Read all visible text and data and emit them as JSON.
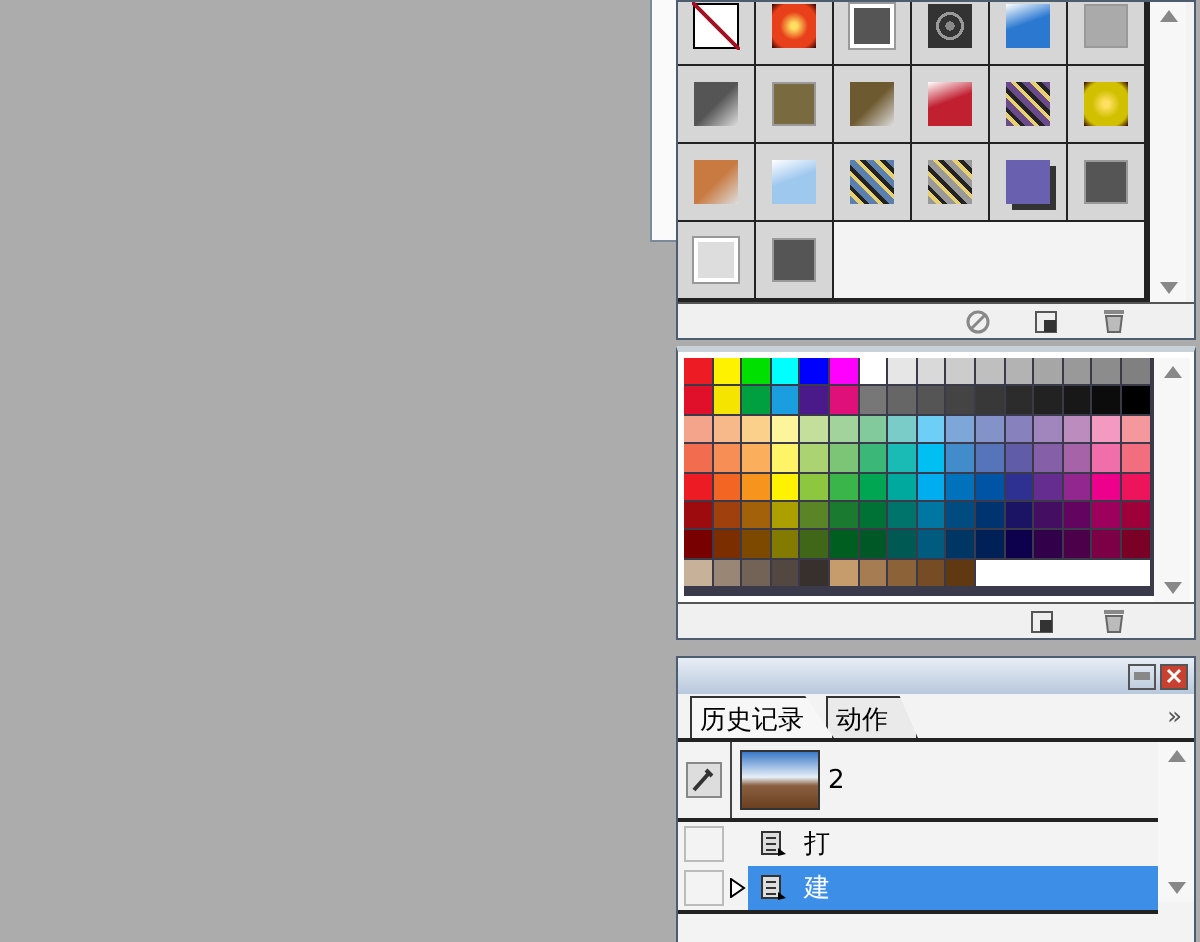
{
  "styles_panel": {
    "tiles": [
      {
        "kind": "none",
        "color": "#ffffff"
      },
      {
        "kind": "glow",
        "color": "#e8401a"
      },
      {
        "kind": "framed",
        "color": "#555555"
      },
      {
        "kind": "chrome",
        "color": "#333333"
      },
      {
        "kind": "glossy",
        "color": "#2a78d0"
      },
      {
        "kind": "flat",
        "color": "#aaaaaa"
      },
      {
        "kind": "gradient",
        "color": "#555555"
      },
      {
        "kind": "flat",
        "color": "#7a6a40"
      },
      {
        "kind": "gradient",
        "color": "#6e5a30"
      },
      {
        "kind": "glossy",
        "color": "#c02030"
      },
      {
        "kind": "pattern",
        "color": "#6a4a8a"
      },
      {
        "kind": "glow",
        "color": "#d0c000"
      },
      {
        "kind": "gradient",
        "color": "#c87a40"
      },
      {
        "kind": "glossy",
        "color": "#9fc8ef"
      },
      {
        "kind": "pattern",
        "color": "#5a80b0"
      },
      {
        "kind": "pattern",
        "color": "#999999"
      },
      {
        "kind": "shadow",
        "color": "#6a60b0"
      },
      {
        "kind": "flat",
        "color": "#555555"
      },
      {
        "kind": "framed",
        "color": "#dddddd"
      },
      {
        "kind": "flat",
        "color": "#555555"
      }
    ]
  },
  "swatches_panel": {
    "rows": [
      [
        {
          "color": "#ed1c24"
        },
        {
          "color": "#fff200"
        },
        {
          "color": "#00e000"
        },
        {
          "color": "#00ffff"
        },
        {
          "color": "#0000ff"
        },
        {
          "color": "#ff00ff"
        },
        {
          "color": "#ffffff"
        },
        {
          "color": "#e6e6e6"
        },
        {
          "color": "#d9d9d9"
        },
        {
          "color": "#cccccc"
        },
        {
          "color": "#bfbfbf"
        },
        {
          "color": "#b3b3b3"
        },
        {
          "color": "#a6a6a6"
        },
        {
          "color": "#999999"
        },
        {
          "color": "#8c8c8c"
        },
        {
          "color": "#808080"
        }
      ],
      [
        {
          "color": "#e0102a"
        },
        {
          "color": "#f5e400"
        },
        {
          "color": "#00a040"
        },
        {
          "color": "#1a9ee0"
        },
        {
          "color": "#4a1a8a"
        },
        {
          "color": "#e0107a"
        },
        {
          "color": "#777777"
        },
        {
          "color": "#666666"
        },
        {
          "color": "#555555"
        },
        {
          "color": "#444444"
        },
        {
          "color": "#383838"
        },
        {
          "color": "#2c2c2c"
        },
        {
          "color": "#222222"
        },
        {
          "color": "#181818"
        },
        {
          "color": "#0c0c0c"
        },
        {
          "color": "#000000"
        }
      ],
      [
        {
          "color": "#f4a48a"
        },
        {
          "color": "#f7b88a"
        },
        {
          "color": "#fbd08a"
        },
        {
          "color": "#fdf59c"
        },
        {
          "color": "#c4df9b"
        },
        {
          "color": "#a3d39c"
        },
        {
          "color": "#82ca9c"
        },
        {
          "color": "#7accc8"
        },
        {
          "color": "#6dcff6"
        },
        {
          "color": "#7da7d9"
        },
        {
          "color": "#8393ca"
        },
        {
          "color": "#8781bd"
        },
        {
          "color": "#a186be"
        },
        {
          "color": "#bd8cbf"
        },
        {
          "color": "#f49ac1"
        },
        {
          "color": "#f5989d"
        }
      ],
      [
        {
          "color": "#f26c4f"
        },
        {
          "color": "#f68e55"
        },
        {
          "color": "#fbaf5c"
        },
        {
          "color": "#fff467"
        },
        {
          "color": "#acd372"
        },
        {
          "color": "#7cc576"
        },
        {
          "color": "#3bb878"
        },
        {
          "color": "#1abbb4"
        },
        {
          "color": "#00bff3"
        },
        {
          "color": "#438ccb"
        },
        {
          "color": "#5574b9"
        },
        {
          "color": "#605ca8"
        },
        {
          "color": "#855fa8"
        },
        {
          "color": "#a763a8"
        },
        {
          "color": "#f06ea9"
        },
        {
          "color": "#f26d7d"
        }
      ],
      [
        {
          "color": "#ed1c24"
        },
        {
          "color": "#f26522"
        },
        {
          "color": "#f7941d"
        },
        {
          "color": "#fff200"
        },
        {
          "color": "#8dc63f"
        },
        {
          "color": "#39b54a"
        },
        {
          "color": "#00a651"
        },
        {
          "color": "#00a99d"
        },
        {
          "color": "#00aeef"
        },
        {
          "color": "#0072bc"
        },
        {
          "color": "#0054a6"
        },
        {
          "color": "#2e3192"
        },
        {
          "color": "#662d91"
        },
        {
          "color": "#92278f"
        },
        {
          "color": "#ec008c"
        },
        {
          "color": "#ed145b"
        }
      ],
      [
        {
          "color": "#9e0b0f"
        },
        {
          "color": "#a0410d"
        },
        {
          "color": "#a36209"
        },
        {
          "color": "#aba000"
        },
        {
          "color": "#598527"
        },
        {
          "color": "#1a7b30"
        },
        {
          "color": "#007236"
        },
        {
          "color": "#00746b"
        },
        {
          "color": "#0076a3"
        },
        {
          "color": "#004b80"
        },
        {
          "color": "#003471"
        },
        {
          "color": "#1b1464"
        },
        {
          "color": "#440e62"
        },
        {
          "color": "#630460"
        },
        {
          "color": "#9e005d"
        },
        {
          "color": "#9e0039"
        }
      ],
      [
        {
          "color": "#790000"
        },
        {
          "color": "#7b2e00"
        },
        {
          "color": "#7d4900"
        },
        {
          "color": "#827b00"
        },
        {
          "color": "#406618"
        },
        {
          "color": "#005e20"
        },
        {
          "color": "#005826"
        },
        {
          "color": "#005952"
        },
        {
          "color": "#005b7f"
        },
        {
          "color": "#003663"
        },
        {
          "color": "#002157"
        },
        {
          "color": "#0d004c"
        },
        {
          "color": "#32004b"
        },
        {
          "color": "#4b0049"
        },
        {
          "color": "#7b0046"
        },
        {
          "color": "#7a0026"
        }
      ],
      [
        {
          "color": "#c7b299"
        },
        {
          "color": "#998675"
        },
        {
          "color": "#736357"
        },
        {
          "color": "#534741"
        },
        {
          "color": "#37302d"
        },
        {
          "color": "#c69c6d"
        },
        {
          "color": "#a67c52"
        },
        {
          "color": "#8c6239"
        },
        {
          "color": "#754c24"
        },
        {
          "color": "#603913"
        }
      ]
    ]
  },
  "history_panel": {
    "tabs": [
      {
        "label": "历史记录",
        "selected": true
      },
      {
        "label": "动作",
        "selected": false
      }
    ],
    "menu_glyph": "»",
    "snapshot": {
      "name": "2"
    },
    "items": [
      {
        "label": "打",
        "selected": false
      },
      {
        "label": "建",
        "selected": true
      }
    ]
  }
}
